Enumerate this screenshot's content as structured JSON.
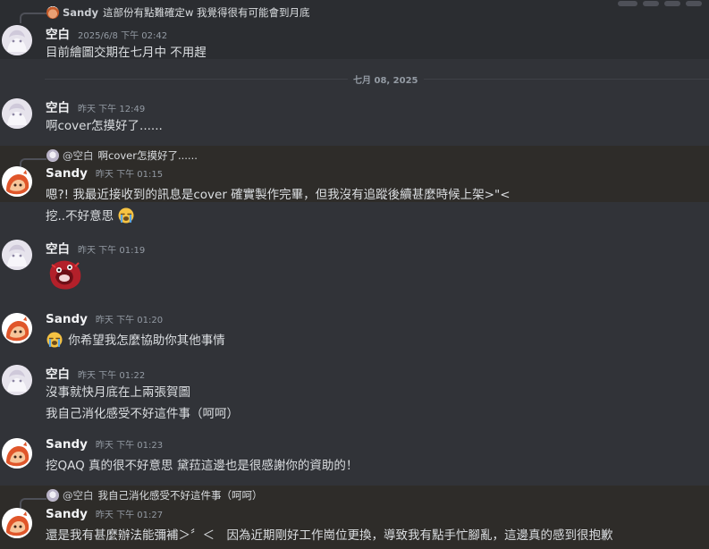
{
  "messages": [
    {
      "author": "空白",
      "timestamp": "2025/6/8 下午 02:42",
      "reply": {
        "author": "Sandy",
        "text": "這部份有點難確定w  我覺得很有可能會到月底"
      },
      "lines": [
        "目前繪圖交期在七月中 不用趕"
      ]
    },
    {
      "author": "空白",
      "timestamp": "昨天 下午 12:49",
      "lines": [
        "啊cover怎摸好了......"
      ]
    },
    {
      "author": "Sandy",
      "timestamp": "昨天 下午 01:15",
      "reply": {
        "mention": "@空白",
        "text": "啊cover怎摸好了......"
      },
      "lines": [
        "嗯?! 我最近接收到的訊息是cover 確實製作完畢，但我沒有追蹤後續甚麼時候上架>\"<",
        "挖..不好意思"
      ]
    },
    {
      "author": "空白",
      "timestamp": "昨天 下午 01:19",
      "sticker": "sticker-red-creature"
    },
    {
      "author": "Sandy",
      "timestamp": "昨天 下午 01:20",
      "lines": [
        "你希望我怎麼協助你其他事情"
      ]
    },
    {
      "author": "空白",
      "timestamp": "昨天 下午 01:22",
      "lines": [
        "沒事就快月底在上兩張賀圖",
        "我自己消化感受不好這件事（呵呵）"
      ]
    },
    {
      "author": "Sandy",
      "timestamp": "昨天 下午 01:23",
      "lines": [
        "挖QAQ 真的很不好意思 黛菈這邊也是很感謝你的資助的！"
      ]
    },
    {
      "author": "Sandy",
      "timestamp": "昨天 下午 01:27",
      "reply": {
        "mention": "@空白",
        "text": "我自己消化感受不好這件事（呵呵）"
      },
      "lines": [
        "還是我有甚麼辦法能彌補＞〞＜　因為近期剛好工作崗位更換，導致我有點手忙腳亂，這邊真的感到很抱歉"
      ]
    }
  ],
  "date_divider": "七月 08, 2025",
  "icons": {
    "crying_emoji": "loudly-crying-face-icon"
  },
  "colors": {
    "background": "#313338",
    "highlight": "#2e2c29",
    "text": "#dbdee1",
    "muted": "#949ba4"
  }
}
